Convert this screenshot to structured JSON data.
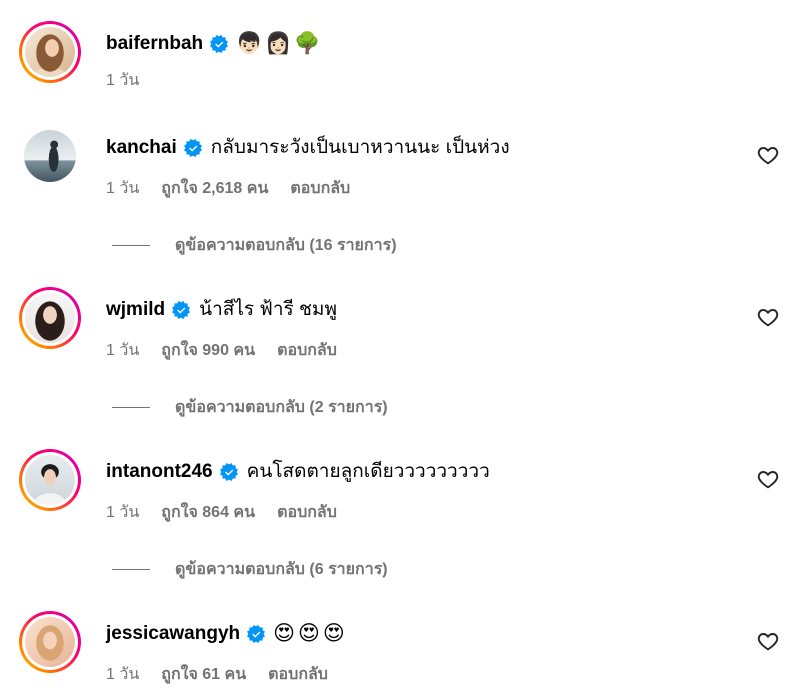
{
  "comments": [
    {
      "username": "baifernbah",
      "verified": true,
      "story_ring": true,
      "text": "👦🏻👩🏻🌳",
      "time": "1 วัน"
    },
    {
      "username": "kanchai",
      "verified": true,
      "story_ring": false,
      "text": "กลับมาระวังเป็นเบาหวานนะ เป็นห่วง",
      "time": "1 วัน",
      "likes": "ถูกใจ 2,618 คน",
      "reply_label": "ตอบกลับ",
      "view_replies": "ดูข้อความตอบกลับ (16 รายการ)"
    },
    {
      "username": "wjmild",
      "verified": true,
      "story_ring": true,
      "text": "น้าสีไร ฟ้ารี ชมพู",
      "time": "1 วัน",
      "likes": "ถูกใจ 990 คน",
      "reply_label": "ตอบกลับ",
      "view_replies": "ดูข้อความตอบกลับ (2 รายการ)"
    },
    {
      "username": "intanont246",
      "verified": true,
      "story_ring": true,
      "text": "คนโสดตายลูกเดียววววววววว",
      "time": "1 วัน",
      "likes": "ถูกใจ 864 คน",
      "reply_label": "ตอบกลับ",
      "view_replies": "ดูข้อความตอบกลับ (6 รายการ)"
    },
    {
      "username": "jessicawangyh",
      "verified": true,
      "story_ring": true,
      "text": "😍😍😍",
      "time": "1 วัน",
      "likes": "ถูกใจ 61 คน",
      "reply_label": "ตอบกลับ"
    }
  ],
  "icons": {
    "verified": "verified-badge-icon",
    "like": "heart-icon"
  },
  "colors": {
    "primary_text": "#000000",
    "secondary_text": "#737373",
    "verified_badge": "#0095f6",
    "icon": "#262626",
    "story_ring": [
      "#ffd600",
      "#ff7a00",
      "#ff0069",
      "#d300c5"
    ]
  }
}
